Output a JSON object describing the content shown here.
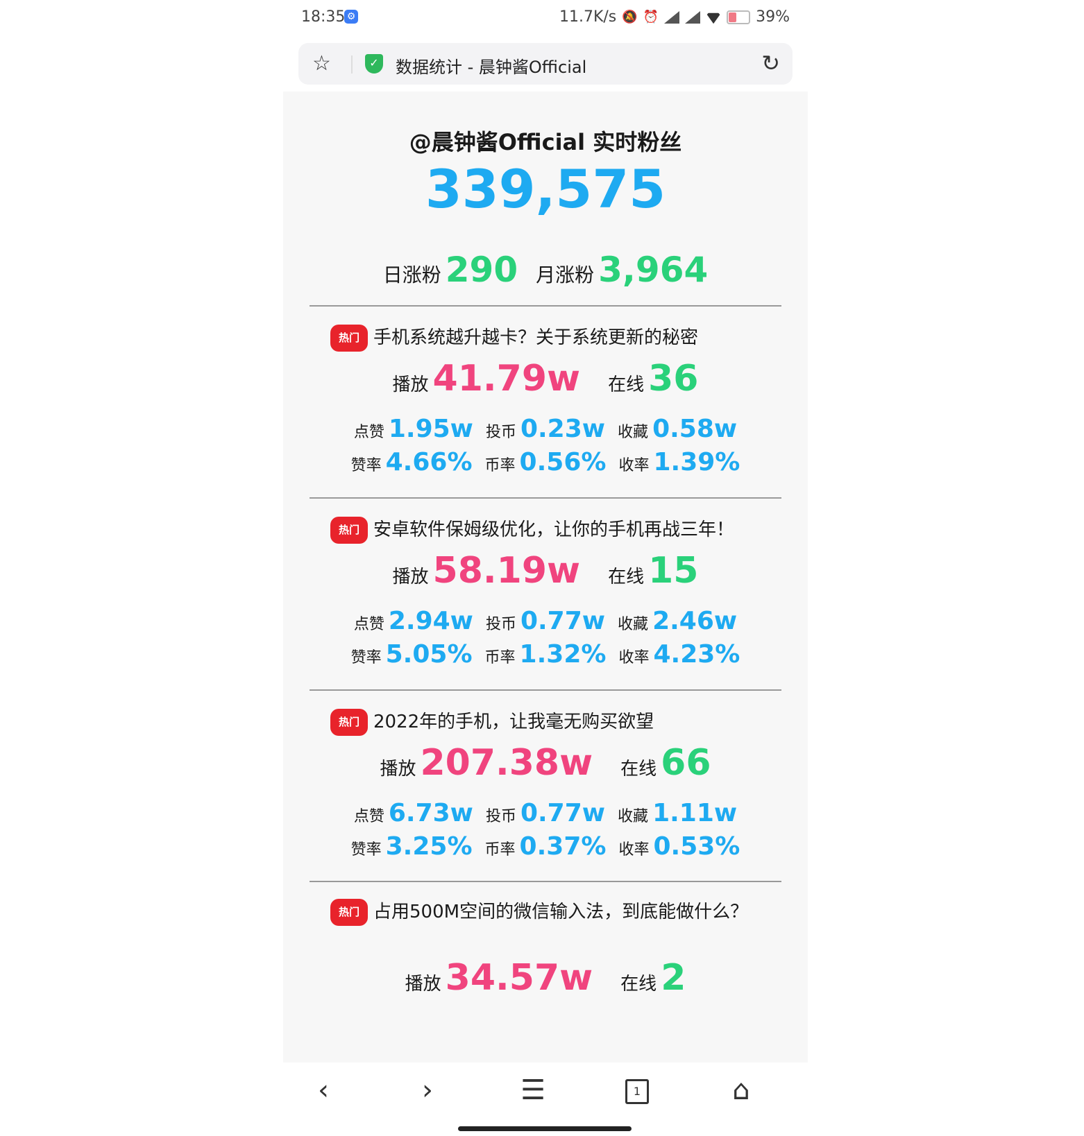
{
  "status": {
    "time": "18:35",
    "gear_icon": "gear-icon",
    "net_speed": "11.7K/s",
    "battery": "39%",
    "battery_level": 0.39
  },
  "urlbar": {
    "title": "数据统计 - 晨钟酱Official"
  },
  "header": {
    "title": "@晨钟酱Official 实时粉丝",
    "fans": "339,575",
    "daily_label": "日涨粉",
    "daily_value": "290",
    "monthly_label": "月涨粉",
    "monthly_value": "3,964"
  },
  "labels": {
    "hot": "热门",
    "play": "播放",
    "online": "在线",
    "like": "点赞",
    "coin": "投币",
    "fav": "收藏",
    "like_rate": "赞率",
    "coin_rate": "币率",
    "fav_rate": "收率"
  },
  "videos": [
    {
      "title": "手机系统越升越卡？关于系统更新的秘密",
      "play": "41.79w",
      "online": "36",
      "like": "1.95w",
      "coin": "0.23w",
      "fav": "0.58w",
      "like_rate": "4.66%",
      "coin_rate": "0.56%",
      "fav_rate": "1.39%"
    },
    {
      "title": "安卓软件保姆级优化，让你的手机再战三年！",
      "play": "58.19w",
      "online": "15",
      "like": "2.94w",
      "coin": "0.77w",
      "fav": "2.46w",
      "like_rate": "5.05%",
      "coin_rate": "1.32%",
      "fav_rate": "4.23%"
    },
    {
      "title": "2022年的手机，让我毫无购买欲望",
      "play": "207.38w",
      "online": "66",
      "like": "6.73w",
      "coin": "0.77w",
      "fav": "1.11w",
      "like_rate": "3.25%",
      "coin_rate": "0.37%",
      "fav_rate": "0.53%"
    },
    {
      "title": "占用500M空间的微信输入法，到底能做什么？",
      "play": "34.57w",
      "online": "2"
    }
  ],
  "bottom_nav": {
    "tab_count": "1"
  }
}
